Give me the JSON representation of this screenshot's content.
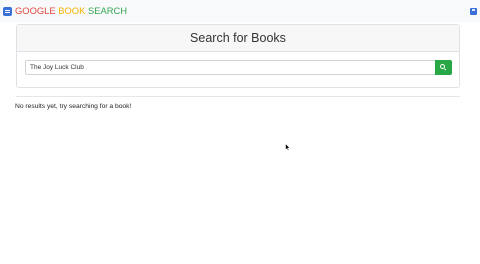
{
  "navbar": {
    "brand": [
      {
        "text": "GOOGLE",
        "color": "#e2483d"
      },
      {
        "text": " ",
        "color": "#333333"
      },
      {
        "text": "BOOK",
        "color": "#f4b400"
      },
      {
        "text": " ",
        "color": "#333333"
      },
      {
        "text": "SEARCH",
        "color": "#34a853"
      }
    ],
    "brand_icon": "book-icon",
    "saved_icon": "save-icon"
  },
  "search_card": {
    "title": "Search for Books",
    "input_value": "The Joy Luck Club",
    "button_icon": "search-icon"
  },
  "results": {
    "empty_message": "No results yet, try searching for a book!"
  },
  "colors": {
    "accent_blue": "#3b6fd8",
    "button_green": "#28a745"
  }
}
